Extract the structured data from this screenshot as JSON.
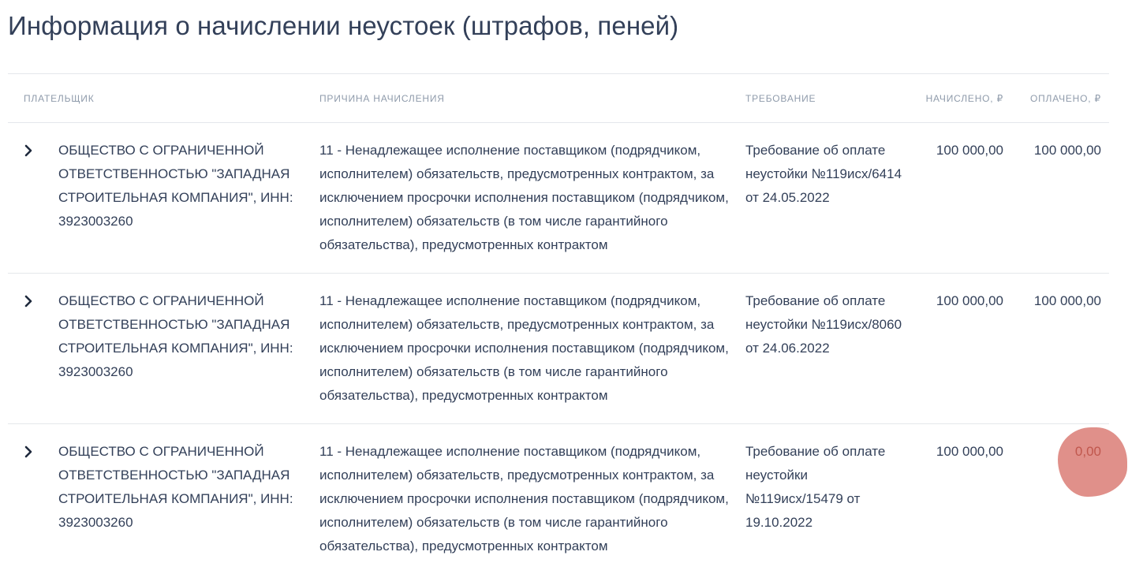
{
  "page": {
    "title": "Информация о начислении неустоек (штрафов, пеней)"
  },
  "table": {
    "columns": {
      "payer": "ПЛАТЕЛЬЩИК",
      "reason": "ПРИЧИНА НАЧИСЛЕНИЯ",
      "demand": "ТРЕБОВАНИЕ",
      "charged": "НАЧИСЛЕНО, ₽",
      "paid": "ОПЛАЧЕНО, ₽"
    },
    "rows": [
      {
        "payer": "ОБЩЕСТВО С ОГРАНИЧЕННОЙ ОТВЕТСТВЕННОСТЬЮ \"ЗАПАДНАЯ СТРОИТЕЛЬНАЯ КОМПАНИЯ\", ИНН: 3923003260",
        "reason": "11 - Ненадлежащее исполнение поставщиком (подрядчиком, исполнителем) обязательств, предусмотренных контрактом, за исключением просрочки исполнения поставщиком (подрядчиком, исполнителем) обязательств (в том числе гарантийного обязательства), предусмотренных контрактом",
        "demand": "Требование об оплате неустойки №119исх/6414 от 24.05.2022",
        "charged": "100 000,00",
        "paid": "100 000,00"
      },
      {
        "payer": "ОБЩЕСТВО С ОГРАНИЧЕННОЙ ОТВЕТСТВЕННОСТЬЮ \"ЗАПАДНАЯ СТРОИТЕЛЬНАЯ КОМПАНИЯ\", ИНН: 3923003260",
        "reason": "11 - Ненадлежащее исполнение поставщиком (подрядчиком, исполнителем) обязательств, предусмотренных контрактом, за исключением просрочки исполнения поставщиком (подрядчиком, исполнителем) обязательств (в том числе гарантийного обязательства), предусмотренных контрактом",
        "demand": "Требование об оплате неустойки №119исх/8060 от 24.06.2022",
        "charged": "100 000,00",
        "paid": "100 000,00"
      },
      {
        "payer": "ОБЩЕСТВО С ОГРАНИЧЕННОЙ ОТВЕТСТВЕННОСТЬЮ \"ЗАПАДНАЯ СТРОИТЕЛЬНАЯ КОМПАНИЯ\", ИНН: 3923003260",
        "reason": "11 - Ненадлежащее исполнение поставщиком (подрядчиком, исполнителем) обязательств, предусмотренных контрактом, за исключением просрочки исполнения поставщиком (подрядчиком, исполнителем) обязательств (в том числе гарантийного обязательства), предусмотренных контрактом",
        "demand": "Требование об оплате неустойки №119исх/15479 от 19.10.2022",
        "charged": "100 000,00",
        "paid": "0,00"
      }
    ]
  },
  "icons": {
    "expand": "chevron-right-icon"
  },
  "colors": {
    "text": "#334059",
    "header_text": "#8f9bab",
    "divider": "#e4e7eb",
    "highlight_mark": "#e0908a"
  }
}
